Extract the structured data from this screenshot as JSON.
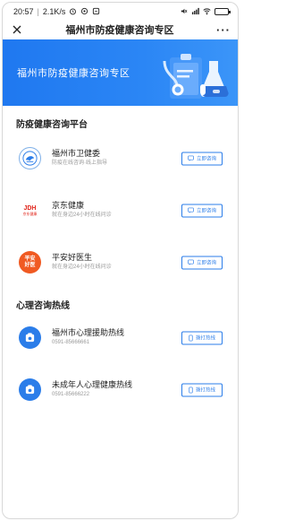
{
  "status_bar": {
    "time": "20:57",
    "speed": "2.1K/s",
    "battery_label": ""
  },
  "nav": {
    "title": "福州市防疫健康咨询专区",
    "more": "···"
  },
  "banner": {
    "title": "福州市防疫健康咨询专区"
  },
  "sections": [
    {
      "title": "防疫健康咨询平台",
      "items": [
        {
          "name": "福州市卫健委",
          "desc": "防疫在线咨询·线上指导",
          "button": "立即咨询"
        },
        {
          "name": "京东健康",
          "desc": "就在身边24小时在线问诊",
          "button": "立即咨询"
        },
        {
          "name": "平安好医生",
          "desc": "就在身边24小时在线问诊",
          "button": "立即咨询"
        }
      ]
    },
    {
      "title": "心理咨询热线",
      "items": [
        {
          "name": "福州市心理援助热线",
          "desc": "0591-85666661",
          "button": "拨打热线"
        },
        {
          "name": "未成年人心理健康热线",
          "desc": "0591-85666222",
          "button": "拨打热线"
        }
      ]
    }
  ],
  "logos": {
    "jd_text": "JDH",
    "jd_sub": "京东健康",
    "pingan_top": "平安",
    "pingan_bottom": "好医"
  },
  "colors": {
    "primary": "#2b7de9",
    "banner": "#2680f2",
    "jd_red": "#e1251b",
    "pingan_orange": "#f05a22"
  }
}
